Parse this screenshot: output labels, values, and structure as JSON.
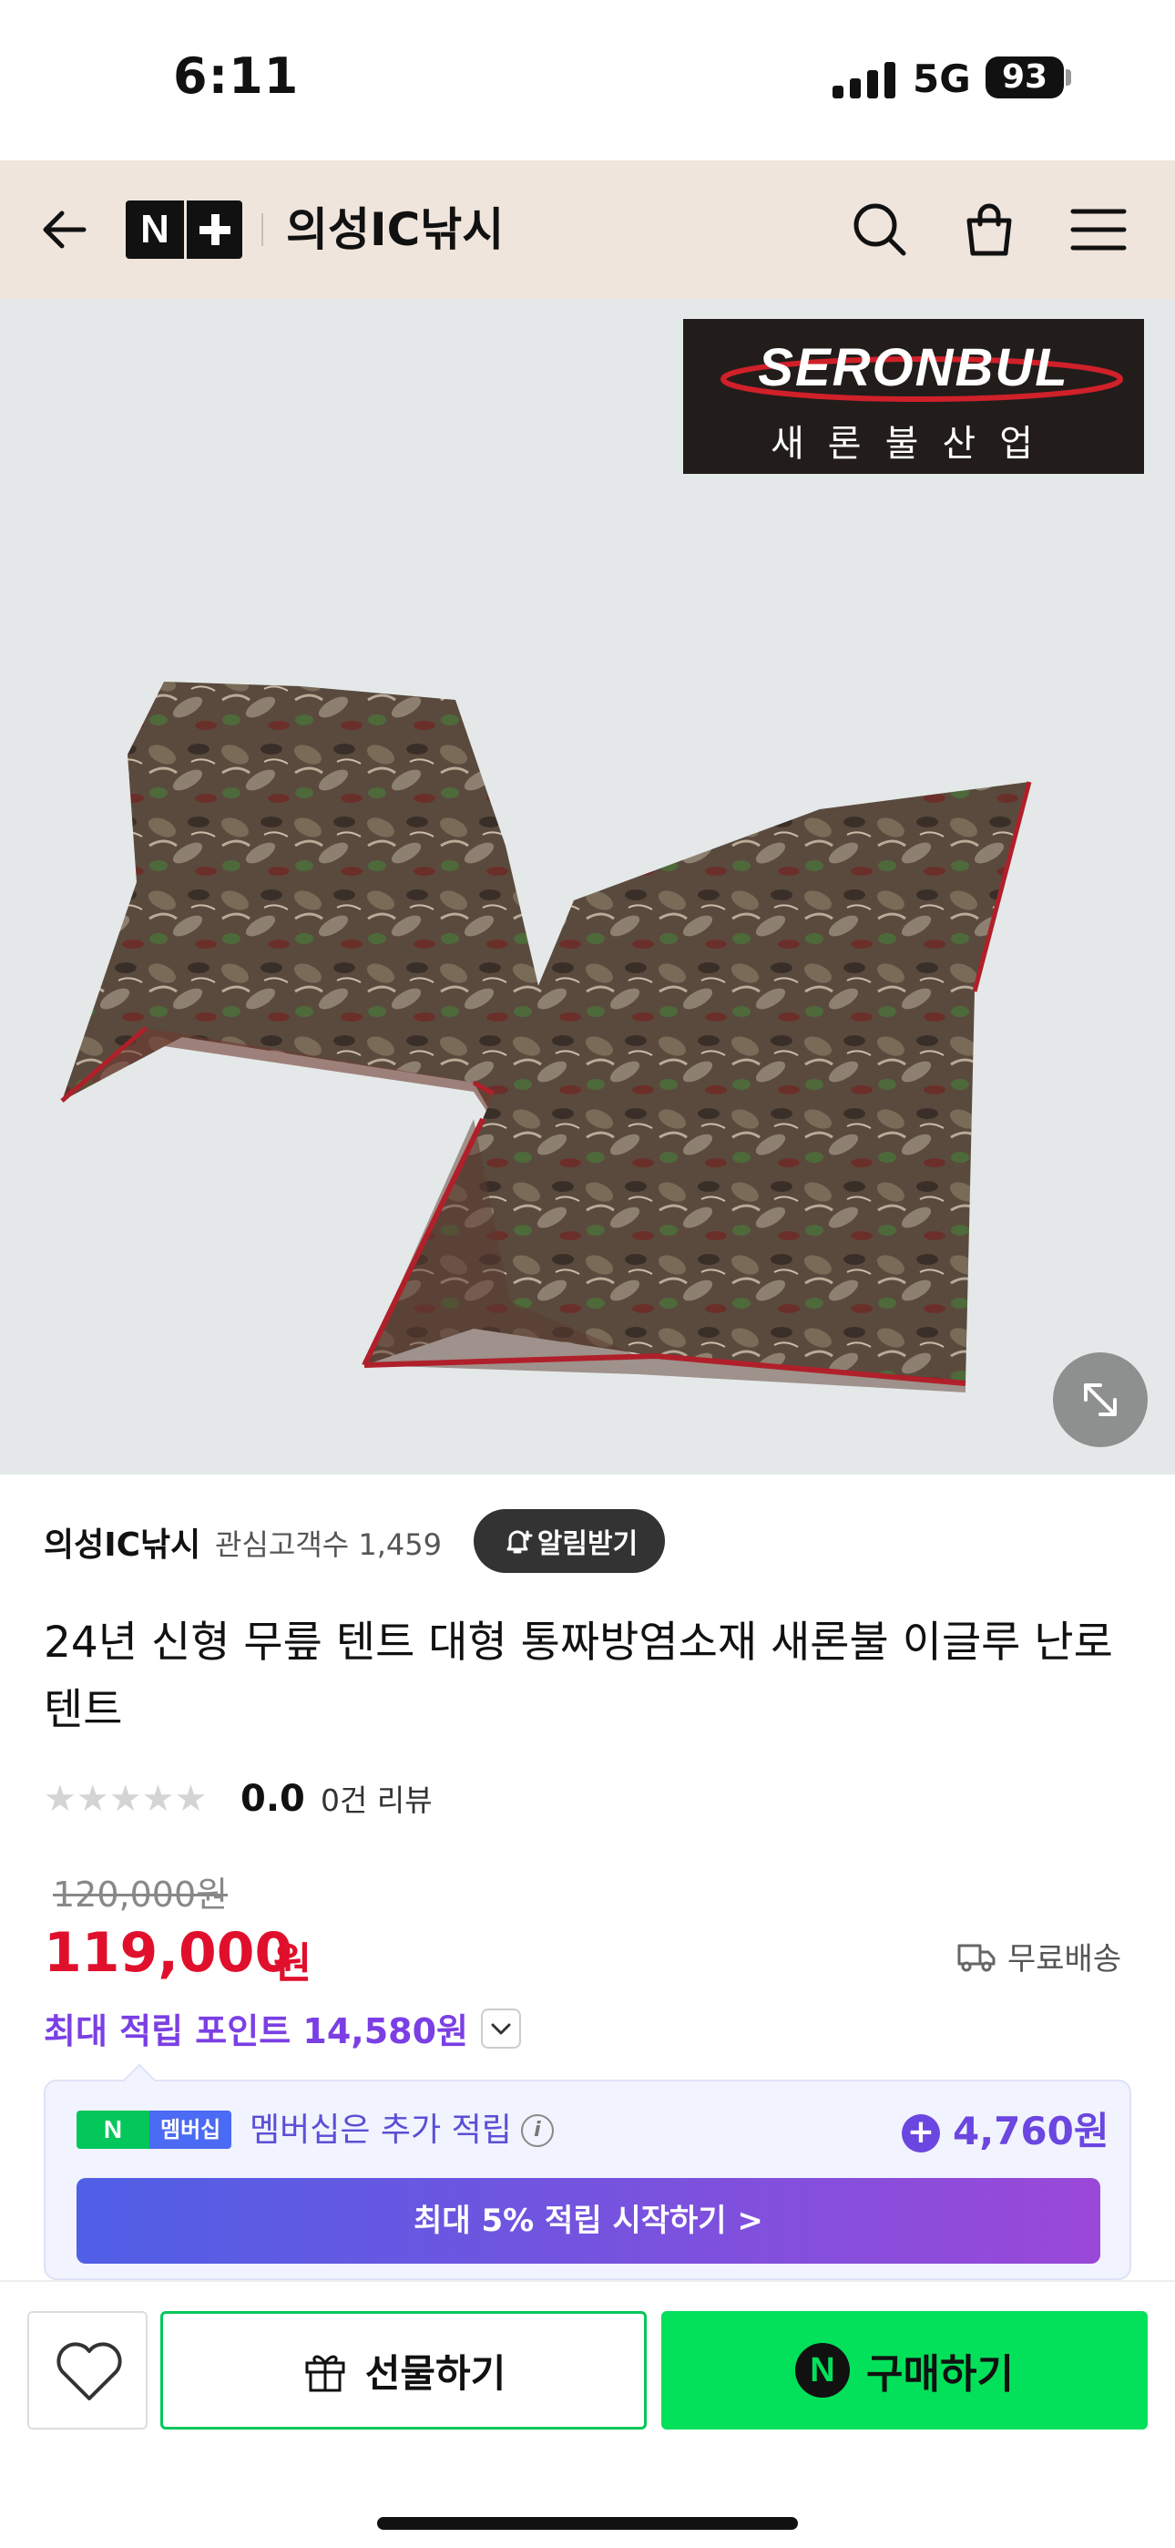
{
  "status_bar": {
    "time": "6:11",
    "network": "5G",
    "battery": "93"
  },
  "header": {
    "logo_text": "N",
    "store_name": "의성IC낚시"
  },
  "hero": {
    "brand_en": "SERONBUL",
    "brand_ko": "새론불산업"
  },
  "info": {
    "store_name": "의성IC낚시",
    "fans": "관심고객수 1,459",
    "alarm_label": "알림받기",
    "title": "24년 신형 무릎 텐트 대형 통짜방염소재 새론불 이글루 난로텐트",
    "rating": "0.0",
    "rating_stars": 0,
    "reviews": "0건 리뷰",
    "old_price": "120,000원",
    "price": "119,000",
    "currency": "원",
    "shipping": "무료배송",
    "points": "최대 적립 포인트 14,580원"
  },
  "membership": {
    "badge_n": "N",
    "badge_label": "멤버십",
    "text": "멤버십은 추가 적립",
    "amount": "4,760원",
    "button_label": "최대 5% 적립 시작하기 >"
  },
  "bottom": {
    "gift_label": "선물하기",
    "buy_icon": "N",
    "buy_label": "구매하기"
  },
  "colors": {
    "header_bg": "#efe5dc",
    "price_red": "#e0102c",
    "points_purple": "#7b3fe4",
    "naver_green": "#03c75a",
    "buy_green": "#03e05a"
  }
}
